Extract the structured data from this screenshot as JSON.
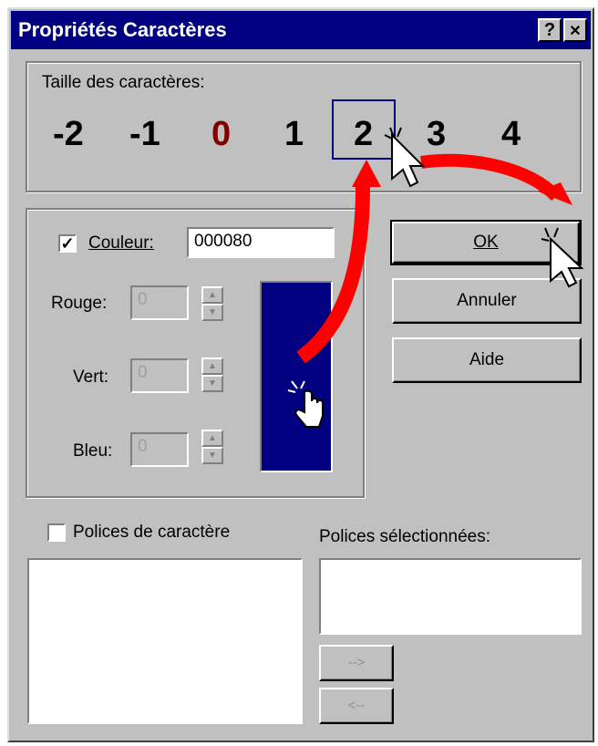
{
  "window": {
    "title": "Propriétés Caractères",
    "help_glyph": "?",
    "close_glyph": "✕"
  },
  "size_group": {
    "label": "Taille des caractères:",
    "sizes": [
      "-2",
      "-1",
      "0",
      "1",
      "2",
      "3",
      "4"
    ],
    "current_size": "0",
    "selected_size": "2"
  },
  "color_group": {
    "checkbox_mark": "✓",
    "couleur_label": "Couleur:",
    "couleur_value": "000080",
    "rouge_label": "Rouge:",
    "rouge_value": "0",
    "vert_label": "Vert:",
    "vert_value": "0",
    "bleu_label": "Bleu:",
    "bleu_value": "0",
    "swatch_color": "#000080",
    "spin_up": "▲",
    "spin_down": "▼"
  },
  "buttons": {
    "ok": "OK",
    "annuler": "Annuler",
    "aide": "Aide",
    "add": "-->",
    "remove": "<--"
  },
  "fonts": {
    "polices_label": "Polices de caractère",
    "selected_label": "Polices sélectionnées:"
  },
  "colors": {
    "title_bar": "#000080",
    "annotation_arrow": "#ff0000",
    "current_size": "#800000"
  },
  "icons": [
    "help-icon",
    "close-icon",
    "arrow-cursor-icon",
    "hand-cursor-icon",
    "click-sparkle-icon",
    "red-annotation-arrow"
  ]
}
